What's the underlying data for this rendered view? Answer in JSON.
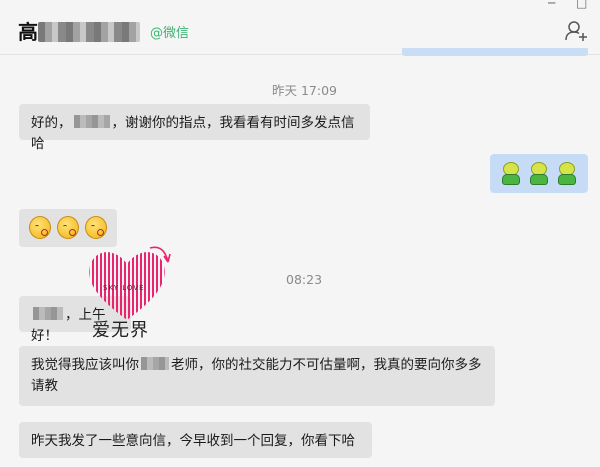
{
  "header": {
    "contact_name": "高",
    "contact_tag": "@微信",
    "add_member_icon": "add-member-icon",
    "window_controls": [
      "─",
      "□"
    ]
  },
  "messages": {
    "time1": "昨天 17:09",
    "msg1_prefix": "好的，",
    "msg1_suffix": "，谢谢你的指点，我看看有时间多发点信哈",
    "time2": "08:23",
    "msg3_suffix": "，上午好！",
    "msg4_part1": "我觉得我应该叫你",
    "msg4_part2": "老师，你的社交能力不可估量啊，我真的要向你多多",
    "msg4_line2": "请教",
    "msg5": "昨天我发了一些意向信，今早收到一个回复，你看下哈"
  },
  "watermark": {
    "text": "爱无界",
    "subtext": "SKY LOVE",
    "color": "#e8256e"
  }
}
